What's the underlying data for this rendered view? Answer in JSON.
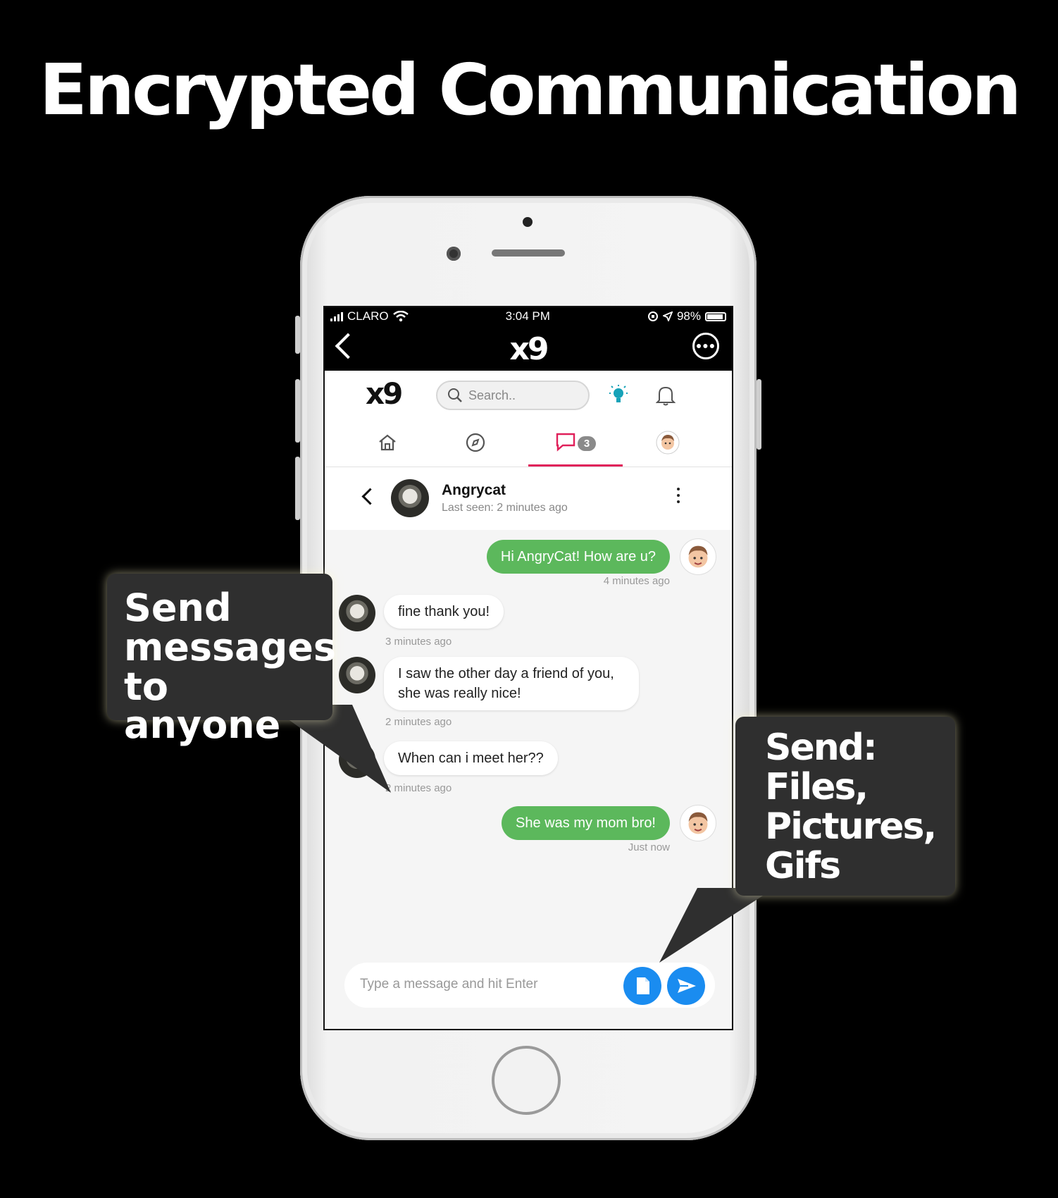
{
  "headline": "Encrypted Communication",
  "callouts": {
    "left": [
      "Send",
      "messages",
      "to anyone"
    ],
    "right": [
      "Send:",
      "Files,",
      "Pictures,",
      "Gifs"
    ]
  },
  "statusbar": {
    "carrier": "CLARO",
    "time": "3:04 PM",
    "battery": "98%"
  },
  "topnav": {
    "logo": "x9",
    "back_icon": "chevron-left-icon",
    "more_icon": "ellipsis-circle-icon"
  },
  "app_header": {
    "logo": "x9",
    "search_placeholder": "Search..",
    "bulb_icon": "lightbulb-icon",
    "bell_icon": "bell-icon",
    "bulb_color": "#17a2b8"
  },
  "tabs": [
    {
      "name": "home",
      "icon": "home-icon"
    },
    {
      "name": "explore",
      "icon": "compass-icon"
    },
    {
      "name": "messages",
      "icon": "chat-bubble-icon",
      "badge": "3",
      "active": true
    },
    {
      "name": "profile",
      "icon": "avatar-icon"
    }
  ],
  "conversation": {
    "name": "Angrycat",
    "last_seen": "Last seen: 2 minutes ago"
  },
  "messages": [
    {
      "from": "me",
      "text": "Hi AngryCat! How are u?",
      "time": "4 minutes ago"
    },
    {
      "from": "them",
      "text": "fine thank you!",
      "time": "3 minutes ago"
    },
    {
      "from": "them",
      "text": "I saw the other day a friend of you, she was really nice!",
      "time": "2 minutes ago"
    },
    {
      "from": "them",
      "text": "When can i meet her??",
      "time": "2 minutes ago"
    },
    {
      "from": "me",
      "text": "She was my mom bro!",
      "time": "Just now"
    }
  ],
  "composer": {
    "placeholder": "Type a message and hit Enter",
    "attach_icon": "file-icon",
    "send_icon": "send-icon"
  },
  "colors": {
    "accent": "#e0205a",
    "outgoing_bubble": "#5cb85c",
    "action_blue": "#1a8cf0"
  }
}
